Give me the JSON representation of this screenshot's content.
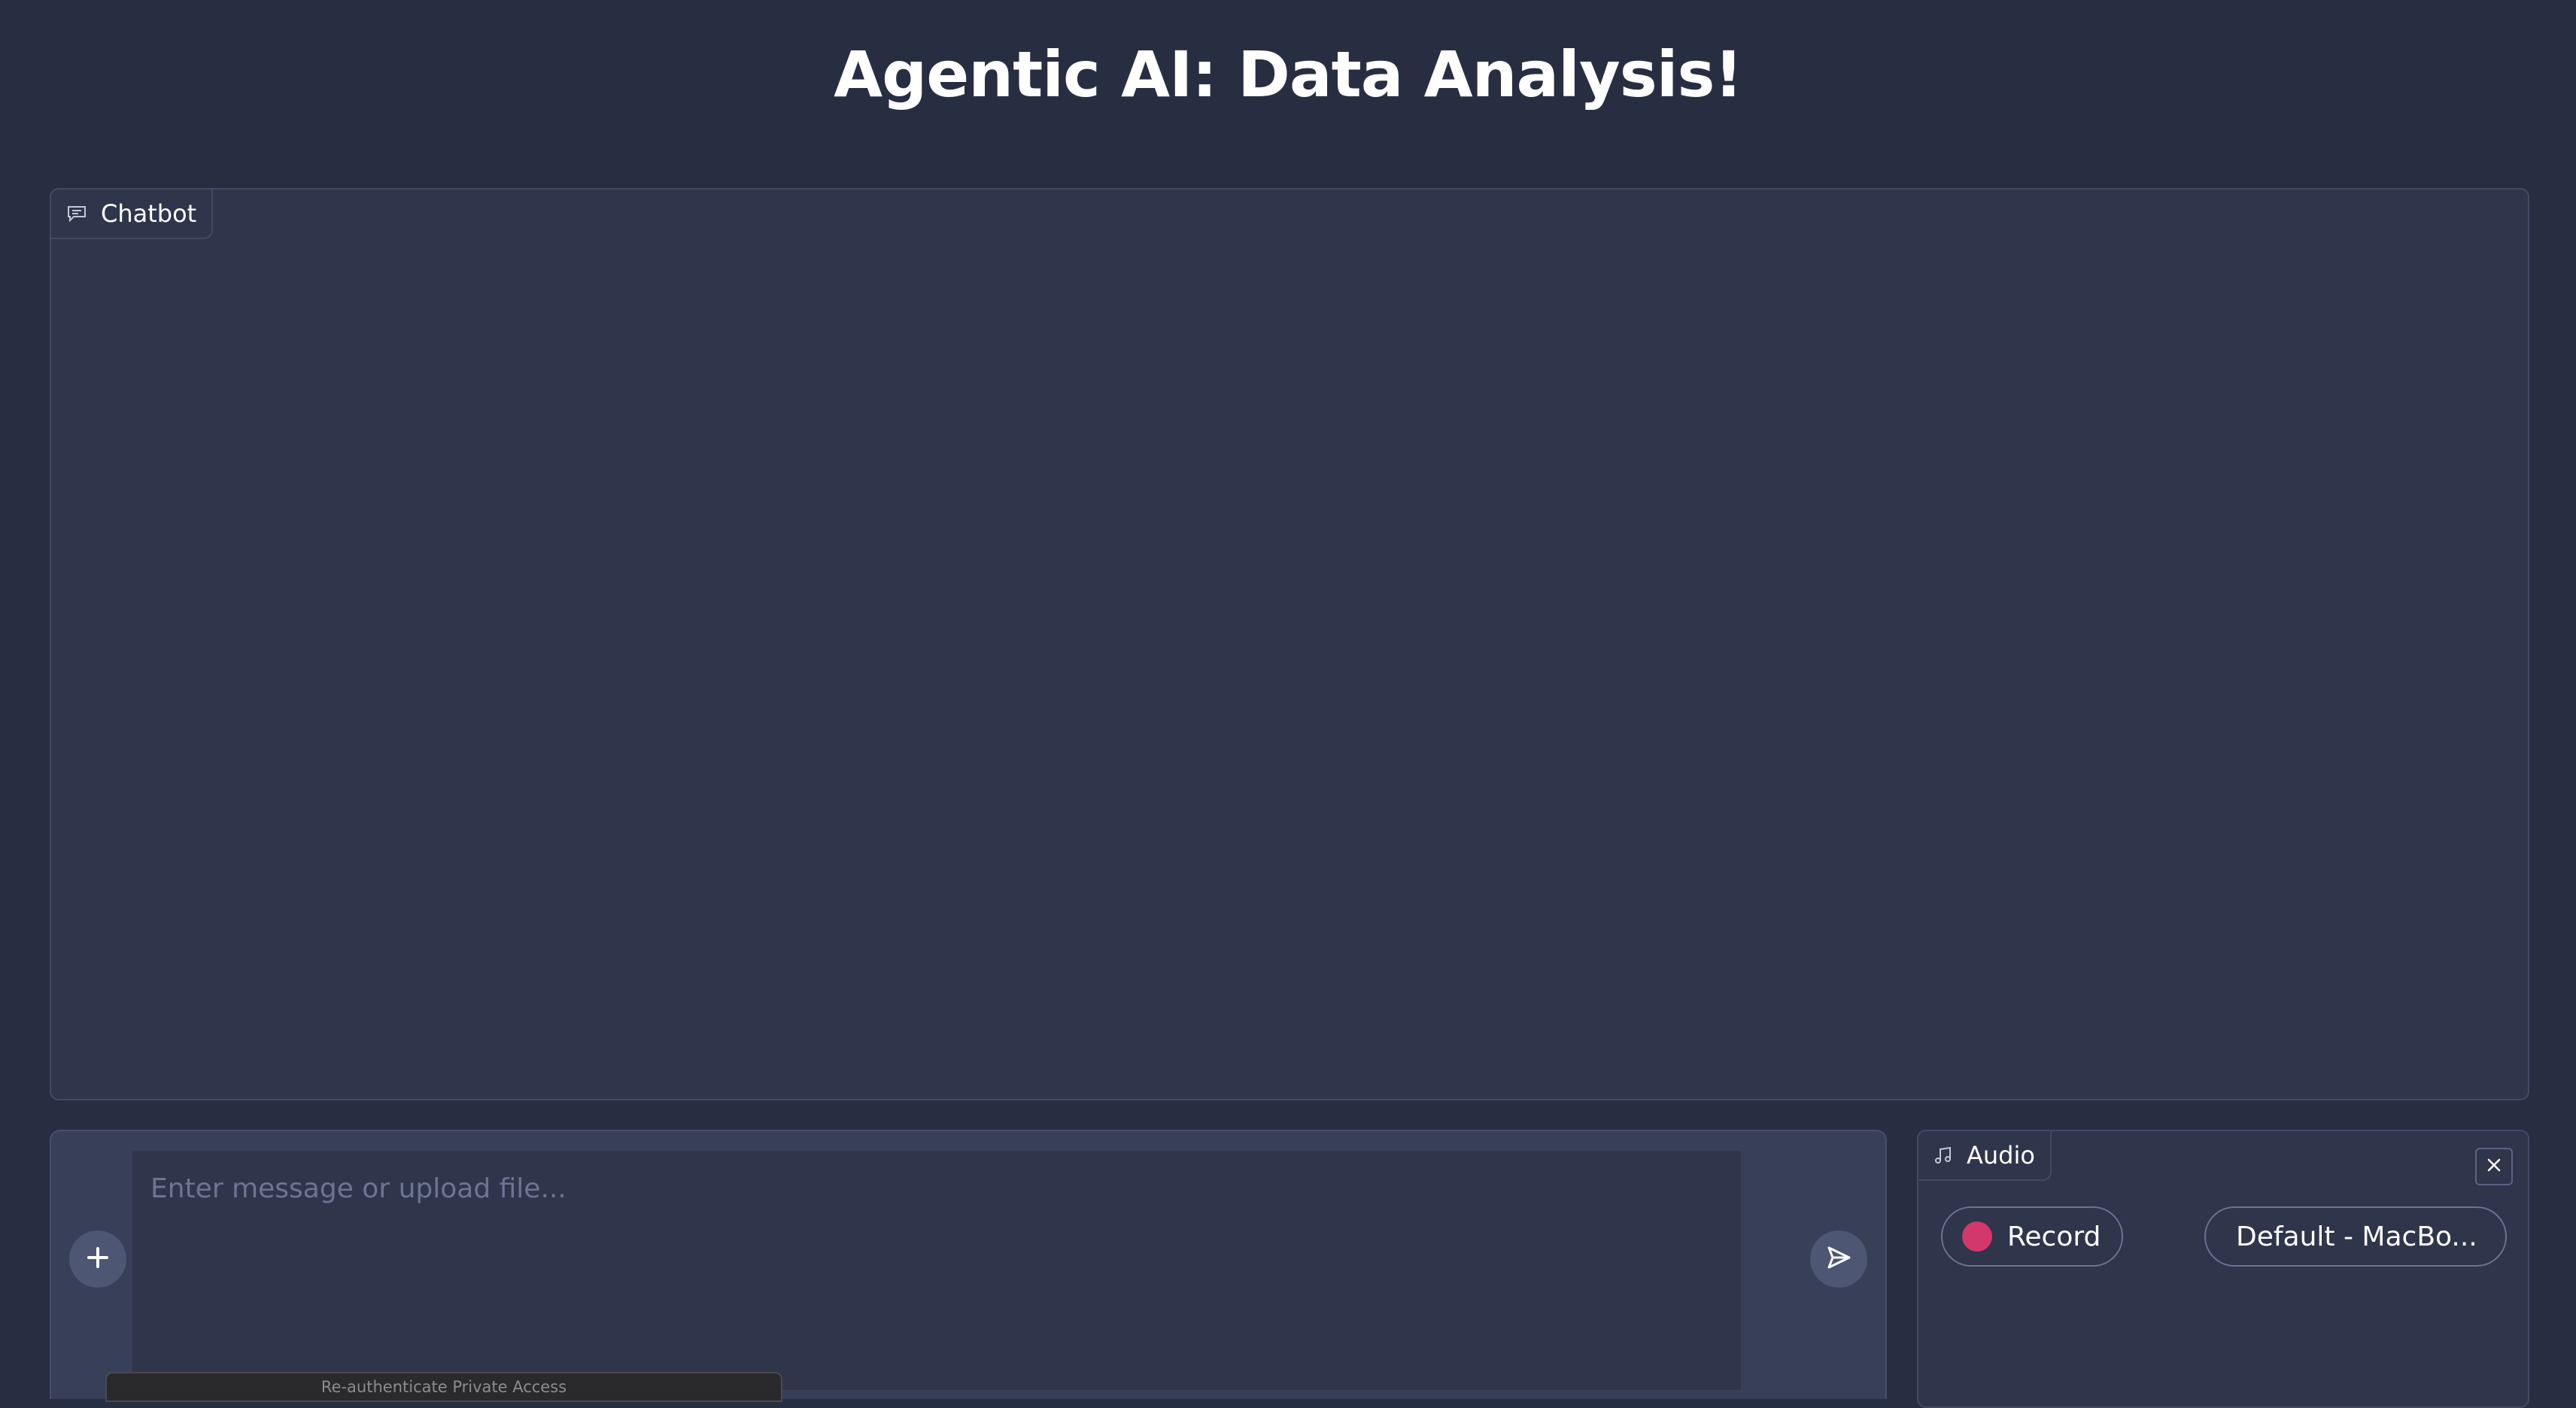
{
  "header": {
    "title": "Agentic AI: Data Analysis!"
  },
  "chatbot": {
    "label": "Chatbot",
    "icon": "chat-icon"
  },
  "composer": {
    "placeholder": "Enter message or upload file...",
    "value": "",
    "add_icon": "plus-icon",
    "send_icon": "send-icon"
  },
  "audio": {
    "label": "Audio",
    "icon": "music-note-icon",
    "close_icon": "close-icon",
    "record_label": "Record",
    "device_selected": "Default - MacBo..."
  },
  "system_banner": {
    "text": "Re-authenticate Private Access"
  },
  "colors": {
    "background": "#282e42",
    "panel": "#2f354b",
    "record_dot": "#d2386c"
  }
}
